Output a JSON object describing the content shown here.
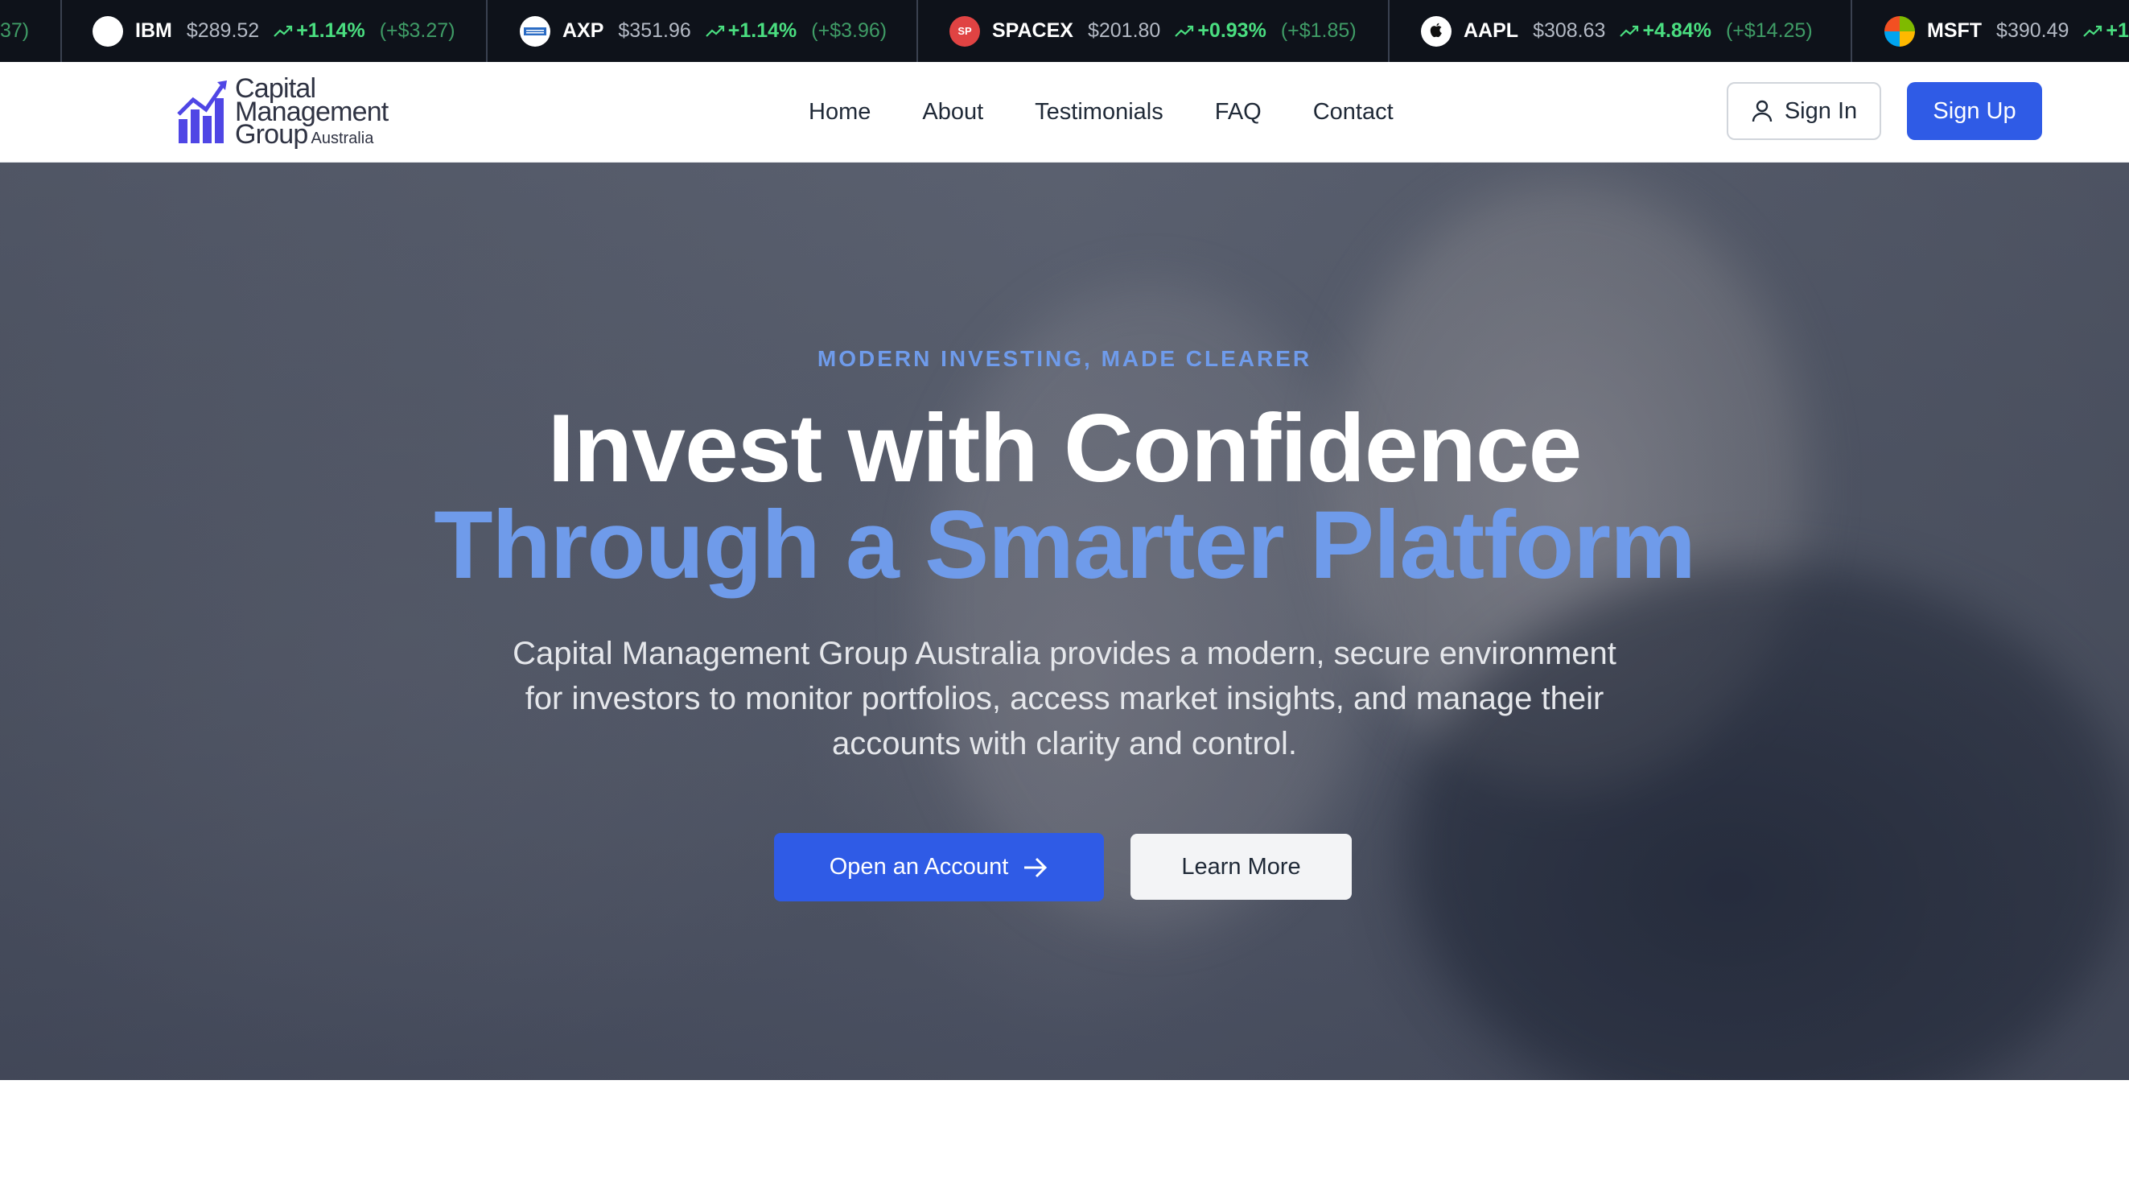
{
  "ticker": {
    "partial_left": "37)",
    "items": [
      {
        "symbol": "IBM",
        "price": "$289.52",
        "change_pct": "+1.14%",
        "change_abs": "(+$3.27)",
        "logo": "ibm-logo-icon"
      },
      {
        "symbol": "AXP",
        "price": "$351.96",
        "change_pct": "+1.14%",
        "change_abs": "(+$3.96)",
        "logo": "amex-logo-icon"
      },
      {
        "symbol": "SPACEX",
        "price": "$201.80",
        "change_pct": "+0.93%",
        "change_abs": "(+$1.85)",
        "logo": "spacex-logo-icon",
        "logo_text": "SP"
      },
      {
        "symbol": "AAPL",
        "price": "$308.63",
        "change_pct": "+4.84%",
        "change_abs": "(+$14.25)",
        "logo": "apple-logo-icon"
      },
      {
        "symbol": "MSFT",
        "price": "$390.49",
        "change_pct": "+1",
        "change_abs": "",
        "logo": "microsoft-logo-icon"
      }
    ]
  },
  "brand": {
    "line1": "Capital",
    "line2": "Management",
    "line3": "Group",
    "line3_sub": "Australia",
    "accent": "#2f5be6",
    "logo_color": "#4f46e5"
  },
  "nav": {
    "links": [
      "Home",
      "About",
      "Testimonials",
      "FAQ",
      "Contact"
    ],
    "signin_label": "Sign In",
    "signup_label": "Sign Up"
  },
  "hero": {
    "kicker": "MODERN INVESTING, MADE CLEARER",
    "title_line1": "Invest with Confidence",
    "title_line2": "Through a Smarter Platform",
    "description": "Capital Management Group Australia provides a modern, secure environment for investors to monitor portfolios, access market insights, and manage their accounts with clarity and control.",
    "primary_cta": "Open an Account",
    "secondary_cta": "Learn More"
  }
}
